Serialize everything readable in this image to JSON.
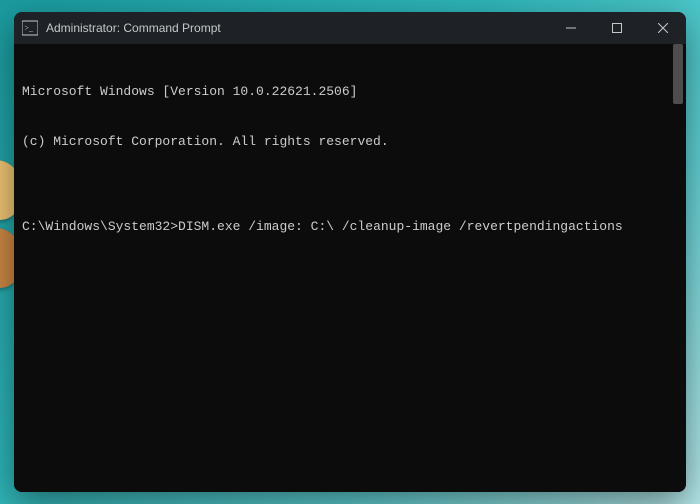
{
  "titlebar": {
    "icon": "cmd-icon",
    "title": "Administrator: Command Prompt",
    "controls": {
      "minimize": "minimize",
      "maximize": "maximize",
      "close": "close"
    }
  },
  "terminal": {
    "lines": {
      "version": "Microsoft Windows [Version 10.0.22621.2506]",
      "copyright": "(c) Microsoft Corporation. All rights reserved.",
      "blank": ""
    },
    "prompt": {
      "path": "C:\\Windows\\System32>",
      "command": "DISM.exe /image: C:\\ /cleanup-image /revertpendingactions"
    }
  }
}
